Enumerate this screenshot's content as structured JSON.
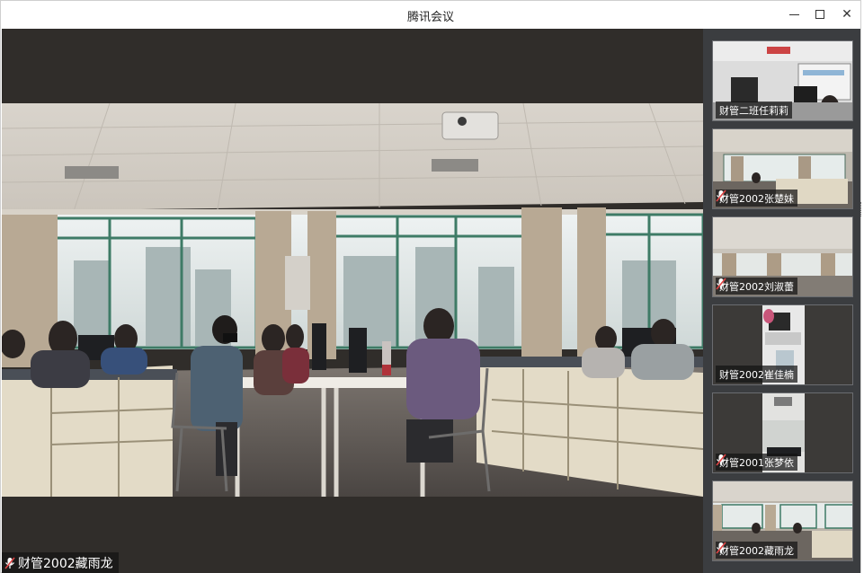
{
  "window": {
    "title": "腾讯会议"
  },
  "main_participant": {
    "name": "财管2002藏雨龙",
    "mic": "muted"
  },
  "participants": [
    {
      "name": "财管二班任莉莉",
      "mic": "none"
    },
    {
      "name": "财管2002张楚妹",
      "mic": "muted"
    },
    {
      "name": "财管2002刘淑蕾",
      "mic": "muted"
    },
    {
      "name": "财管2002崔佳楠",
      "mic": "none"
    },
    {
      "name": "财管2001张梦依",
      "mic": "muted"
    },
    {
      "name": "财管2002藏雨龙",
      "mic": "muted"
    }
  ],
  "icons": [
    "minimize-icon",
    "maximize-icon",
    "close-icon",
    "mic-muted-icon"
  ],
  "colors": {
    "stage_bg": "#302d2a",
    "sidebar_bg": "#3b3d40",
    "mic_accent": "#e04545"
  }
}
